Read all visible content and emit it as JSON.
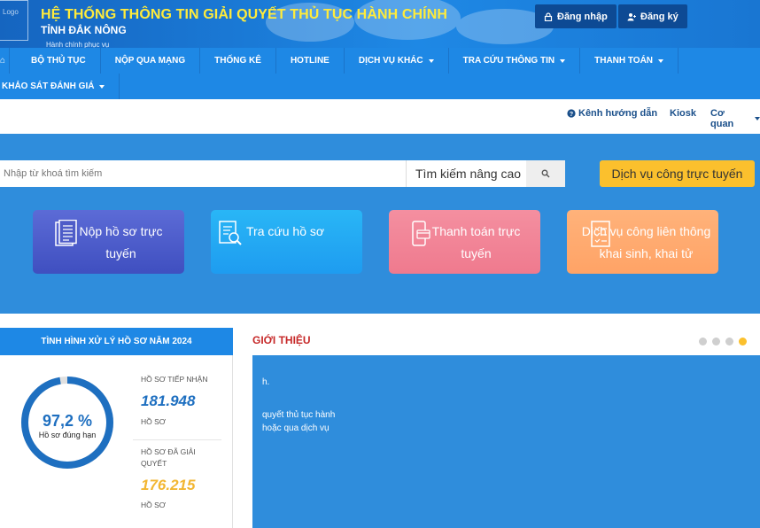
{
  "header": {
    "logo_text": "Logo",
    "title": "HỆ THỐNG THÔNG TIN GIẢI QUYẾT THỦ TỤC HÀNH CHÍNH",
    "subtitle": "TỈNH ĐẮK NÔNG",
    "tagline": "Hành chính phục vụ",
    "login_label": "Đăng nhập",
    "register_label": "Đăng ký"
  },
  "nav": {
    "row1": [
      {
        "label": "BỘ THỦ TỤC",
        "dropdown": false
      },
      {
        "label": "NỘP QUA MẠNG",
        "dropdown": false
      },
      {
        "label": "THỐNG KÊ",
        "dropdown": false
      },
      {
        "label": "HOTLINE",
        "dropdown": false
      },
      {
        "label": "DỊCH VỤ KHÁC",
        "dropdown": true
      },
      {
        "label": "TRA CỨU THÔNG TIN",
        "dropdown": true
      },
      {
        "label": "THANH TOÁN",
        "dropdown": true
      }
    ],
    "row2": [
      {
        "label": "KHẢO SÁT ĐÁNH GIÁ",
        "dropdown": true
      }
    ]
  },
  "utility": {
    "guide_label": "Kênh hướng dẫn",
    "kiosk_label": "Kiosk",
    "agency_label": "Cơ quan"
  },
  "search": {
    "placeholder": "Nhập từ khoá tìm kiếm",
    "advanced_label": "Tìm kiếm nâng cao",
    "online_service_label": "Dịch vụ công trực tuyến"
  },
  "cards": {
    "submit": "Nộp hồ sơ trực tuyến",
    "lookup": "Tra cứu hồ sơ",
    "payment": "Thanh toán trực tuyến",
    "linked": "Dịch vụ công liên thông khai sinh, khai tử"
  },
  "stats": {
    "heading": "TÌNH HÌNH XỬ LÝ HỒ SƠ NĂM 2024",
    "percent_value": 97.2,
    "percent": "97,2 %",
    "percent_label": "Hồ sơ đúng hạn",
    "received_label": "HỒ SƠ TIẾP NHẬN",
    "received_value": "181.948",
    "received_unit": "HỒ SƠ",
    "resolved_label": "HỒ SƠ ĐÃ GIẢI QUYẾT",
    "resolved_value": "176.215",
    "resolved_unit": "HỒ SƠ"
  },
  "intro": {
    "heading": "GIỚI THIỆU",
    "line1": "h.",
    "line2": "quyết thủ tục hành",
    "line3": "hoặc qua dịch vụ",
    "slides": 4,
    "active_slide": 4
  },
  "colors": {
    "primary": "#1e88e5",
    "title_yellow": "#ffeb3b",
    "accent_yellow": "#fbc02d",
    "heading_red": "#c62828"
  }
}
